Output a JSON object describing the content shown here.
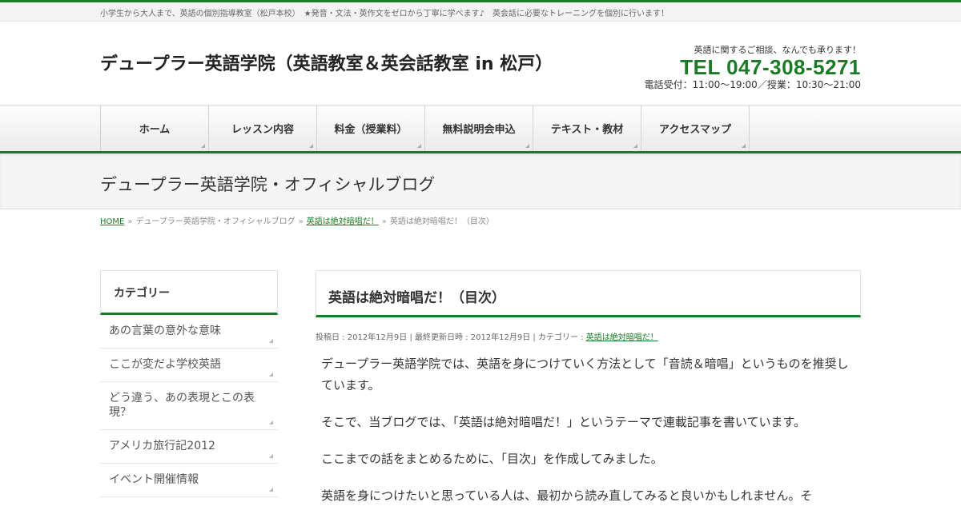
{
  "colors": {
    "accent": "#1a7a25",
    "text": "#333333",
    "link": "#1a7a25"
  },
  "topbar": {
    "text": "小学生から大人まで、英語の個別指導教室（松戸本校）　★発音・文法・英作文をゼロから丁寧に学べます♪　英会話に必要なトレーニングを個別に行います！"
  },
  "header": {
    "title": "デュープラー英語学院（英語教室＆英会話教室 in 松戸）",
    "contact_note": "英語に関するご相談、なんでも承ります！",
    "tel": "TEL 047-308-5271",
    "hours": "電話受付：11:00〜19:00／授業：10:30〜21:00"
  },
  "nav": {
    "items": [
      {
        "label": "ホーム"
      },
      {
        "label": "レッスン内容"
      },
      {
        "label": "料金（授業料）"
      },
      {
        "label": "無料説明会申込"
      },
      {
        "label": "テキスト・教材"
      },
      {
        "label": "アクセスマップ"
      }
    ]
  },
  "page_header": {
    "title": "デュープラー英語学院・オフィシャルブログ"
  },
  "breadcrumb": {
    "home": "HOME",
    "blog": "デュープラー英語学院・オフィシャルブログ",
    "category": "英語は絶対暗唱だ！",
    "current": "英語は絶対暗唱だ！（目次）",
    "sep": "»"
  },
  "sidebar": {
    "heading": "カテゴリー",
    "items": [
      {
        "label": "あの言葉の意外な意味"
      },
      {
        "label": "ここが変だよ学校英語"
      },
      {
        "label": "どう違う、あの表現とこの表現？"
      },
      {
        "label": "アメリカ旅行記2012"
      },
      {
        "label": "イベント開催情報"
      }
    ]
  },
  "article": {
    "title": "英語は絶対暗唱だ！（目次）",
    "meta_prefix": "投稿日 : 2012年12月9日 | 最終更新日時 : 2012年12月9日 | カテゴリー : ",
    "meta_category": "英語は絶対暗唱だ！",
    "paragraphs": [
      "デュープラー英語学院では、英語を身につけていく方法として「音読＆暗唱」というものを推奨しています。",
      "そこで、当ブログでは、「英語は絶対暗唱だ！」というテーマで連載記事を書いています。",
      "ここまでの話をまとめるために、「目次」を作成してみました。",
      "英語を身につけたいと思っている人は、最初から読み直してみると良いかもしれません。そ"
    ]
  }
}
